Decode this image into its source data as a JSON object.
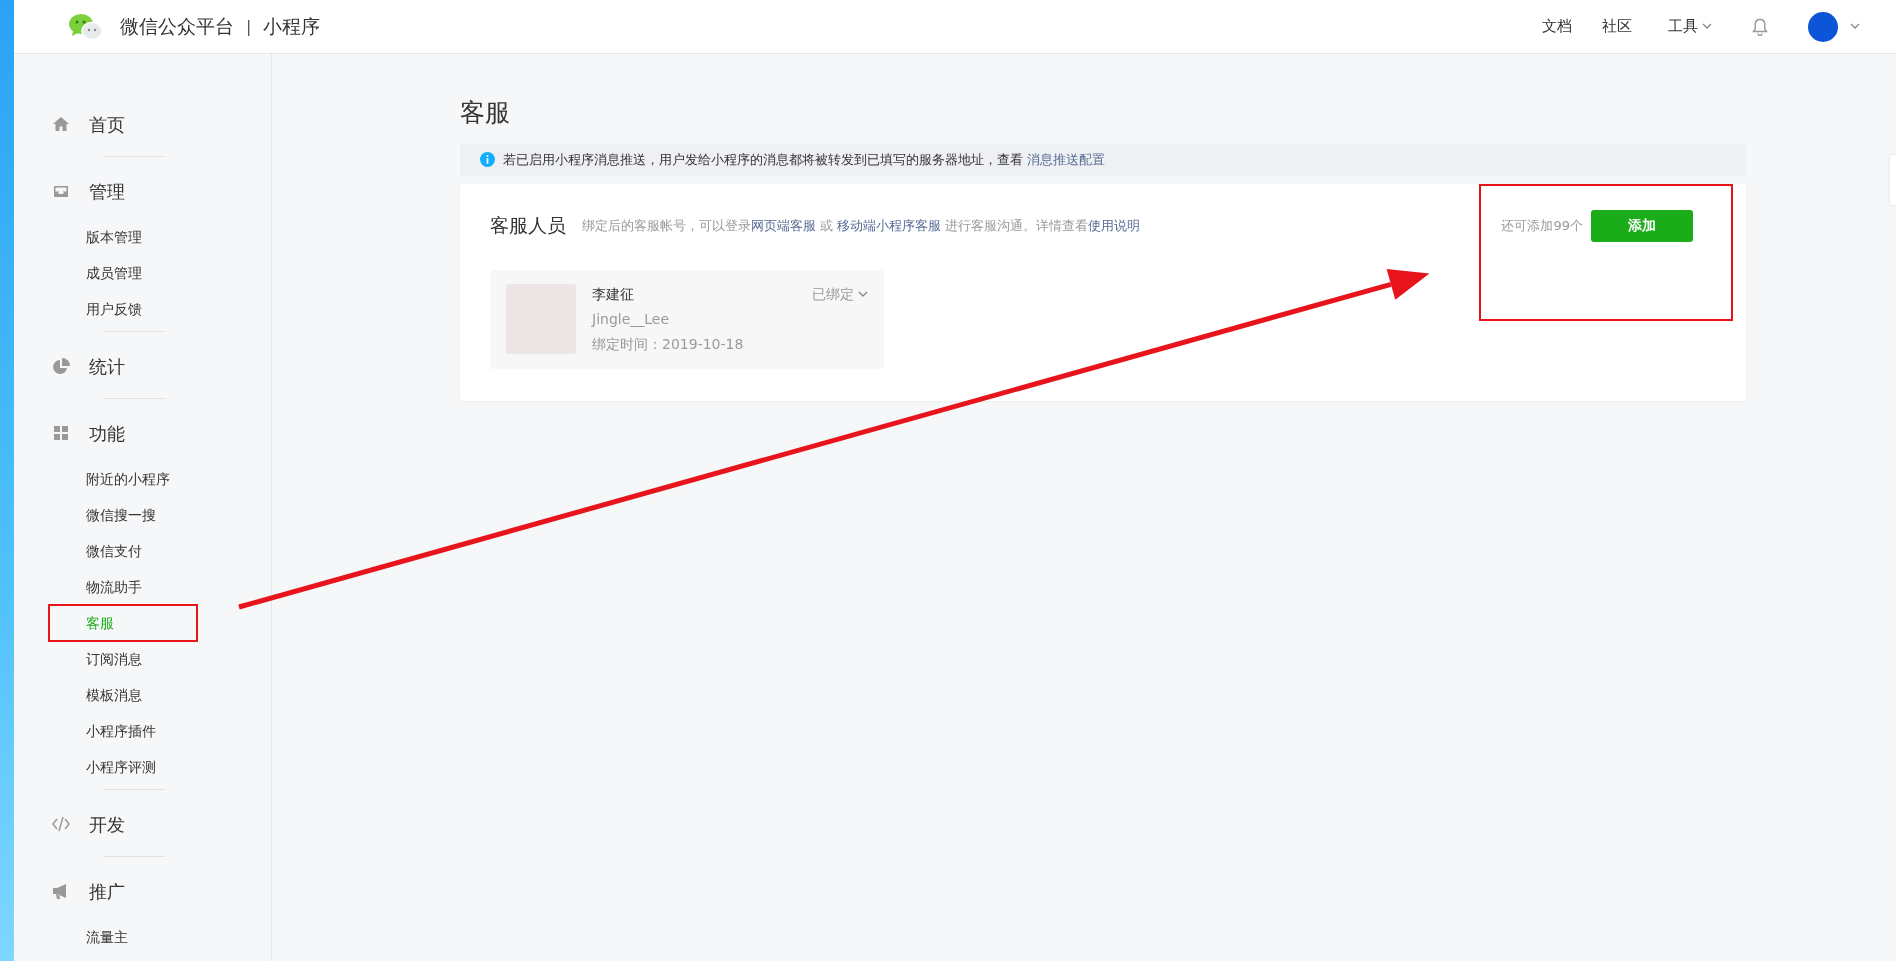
{
  "header": {
    "title": "微信公众平台",
    "separator": "|",
    "subtitle": "小程序",
    "nav": [
      {
        "label": "文档",
        "dropdown": false
      },
      {
        "label": "社区",
        "dropdown": false
      },
      {
        "label": "工具",
        "dropdown": true
      }
    ]
  },
  "sidebar": {
    "sections": [
      {
        "label": "首页"
      },
      {
        "label": "管理",
        "children": [
          {
            "label": "版本管理",
            "selected": false
          },
          {
            "label": "成员管理",
            "selected": false
          },
          {
            "label": "用户反馈",
            "selected": false
          }
        ]
      },
      {
        "label": "统计"
      },
      {
        "label": "功能",
        "children": [
          {
            "label": "附近的小程序",
            "selected": false
          },
          {
            "label": "微信搜一搜",
            "selected": false
          },
          {
            "label": "微信支付",
            "selected": false
          },
          {
            "label": "物流助手",
            "selected": false
          },
          {
            "label": "客服",
            "selected": true,
            "highlighted": true
          },
          {
            "label": "订阅消息",
            "selected": false
          },
          {
            "label": "模板消息",
            "selected": false
          },
          {
            "label": "小程序插件",
            "selected": false
          },
          {
            "label": "小程序评测",
            "selected": false
          }
        ]
      },
      {
        "label": "开发"
      },
      {
        "label": "推广",
        "children": [
          {
            "label": "流量主",
            "selected": false
          }
        ]
      }
    ]
  },
  "page_title": "客服",
  "notice": {
    "text": "若已启用小程序消息推送，用户发给小程序的消息都将被转发到已填写的服务器地址，查看",
    "link": "消息推送配置"
  },
  "staff_card": {
    "title": "客服人员",
    "description": [
      {
        "kind": "text",
        "text": "绑定后的客服帐号，可以登录"
      },
      {
        "kind": "link",
        "text": "网页端客服"
      },
      {
        "kind": "text",
        "text": " 或 "
      },
      {
        "kind": "link",
        "text": "移动端小程序客服"
      },
      {
        "kind": "text",
        "text": " 进行客服沟通。详情查看"
      },
      {
        "kind": "link",
        "text": "使用说明"
      }
    ],
    "remaining": "还可添加99个",
    "add_button": "添加",
    "add_highlighted": true,
    "members": [
      {
        "name": "李建征",
        "account": "Jingle__Lee",
        "bound_time": "绑定时间：2019-10-18",
        "status": "已绑定"
      }
    ]
  },
  "arrow": true
}
